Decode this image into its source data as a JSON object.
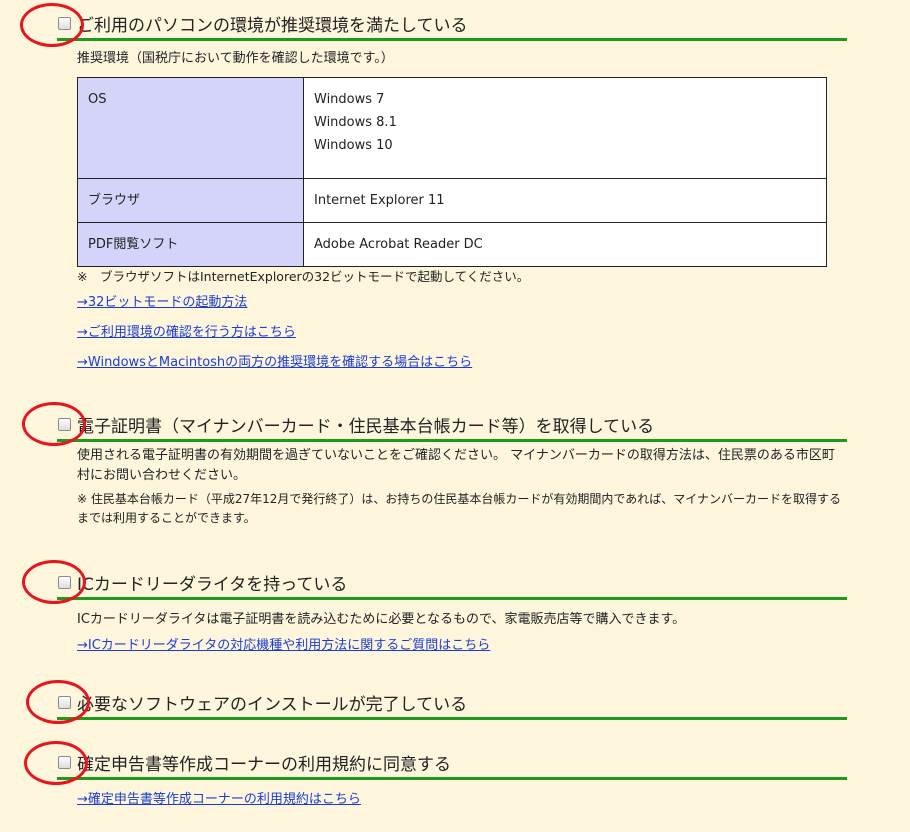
{
  "sections": [
    {
      "heading": "ご利用のパソコンの環境が推奨環境を満たしている",
      "intro": "推奨環境（国税庁において動作を確認した環境です。）",
      "table": {
        "os_label": "OS",
        "os_values": [
          "Windows 7",
          "Windows 8.1",
          "Windows 10"
        ],
        "browser_label": "ブラウザ",
        "browser_value": "Internet Explorer 11",
        "pdf_label": "PDF閲覧ソフト",
        "pdf_value": "Adobe Acrobat Reader DC"
      },
      "note": "※　ブラウザソフトはInternetExplorerの32ビットモードで起動してください。",
      "links": [
        "→32ビットモードの起動方法",
        "→ご利用環境の確認を行う方はこちら",
        "→WindowsとMacintoshの両方の推奨環境を確認する場合はこちら"
      ]
    },
    {
      "heading": "電子証明書（マイナンバーカード・住民基本台帳カード等）を取得している",
      "text1": "使用される電子証明書の有効期間を過ぎていないことをご確認ください。 マイナンバーカードの取得方法は、住民票のある市区町村にお問い合わせください。",
      "text2": "※ 住民基本台帳カード（平成27年12月で発行終了）は、お持ちの住民基本台帳カードが有効期間内であれば、マイナンバーカードを取得するまでは利用することができます。"
    },
    {
      "heading": "ICカードリーダライタを持っている",
      "text": "ICカードリーダライタは電子証明書を読み込むために必要となるもので、家電販売店等で購入できます。",
      "link": "→ICカードリーダライタの対応機種や利用方法に関するご質問はこちら"
    },
    {
      "heading": "必要なソフトウェアのインストールが完了している"
    },
    {
      "heading": "確定申告書等作成コーナーの利用規約に同意する",
      "link": "→確定申告書等作成コーナーの利用規約はこちら"
    }
  ],
  "colors": {
    "background": "#fdf6dc",
    "heading_rule": "#1e9a1e",
    "table_header": "#d4d4fa",
    "link": "#1a3cd4",
    "annotation_circle": "#e8141e"
  }
}
